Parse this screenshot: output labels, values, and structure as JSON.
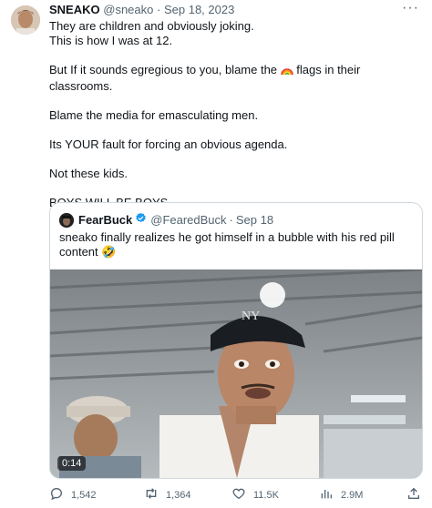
{
  "tweet": {
    "display_name": "SNEAKO",
    "handle": "@sneako",
    "separator": "·",
    "date": "Sep 18, 2023",
    "more_label": "···",
    "lines": [
      "They are children and obviously joking.",
      "This is how I was at 12."
    ],
    "blame_before": "But If it sounds egregious to you, blame the ",
    "blame_after": " flags in their classrooms.",
    "media_line": "Blame the media for emasculating men.",
    "fault_line": "Its YOUR fault for forcing an obvious agenda.",
    "kids_line": "Not these kids.",
    "closing_line": "BOYS WILL BE BOYS"
  },
  "quote": {
    "display_name": "FearBuck",
    "handle": "@FearedBuck",
    "separator": "·",
    "date": "Sep 18",
    "text": "sneako finally realizes he got himself in a bubble with his red pill content 🤣",
    "video_timestamp": "0:14"
  },
  "actions": {
    "replies": "1,542",
    "reposts": "1,364",
    "likes": "11.5K",
    "views": "2.9M"
  },
  "colors": {
    "text": "#0f1419",
    "secondary": "#536471",
    "border": "#cfd9de",
    "verified": "#1d9bf0"
  },
  "icons": [
    "reply-icon",
    "repost-icon",
    "like-icon",
    "views-icon",
    "share-icon",
    "verified-badge-icon",
    "rainbow-flag-icon",
    "more-icon"
  ]
}
